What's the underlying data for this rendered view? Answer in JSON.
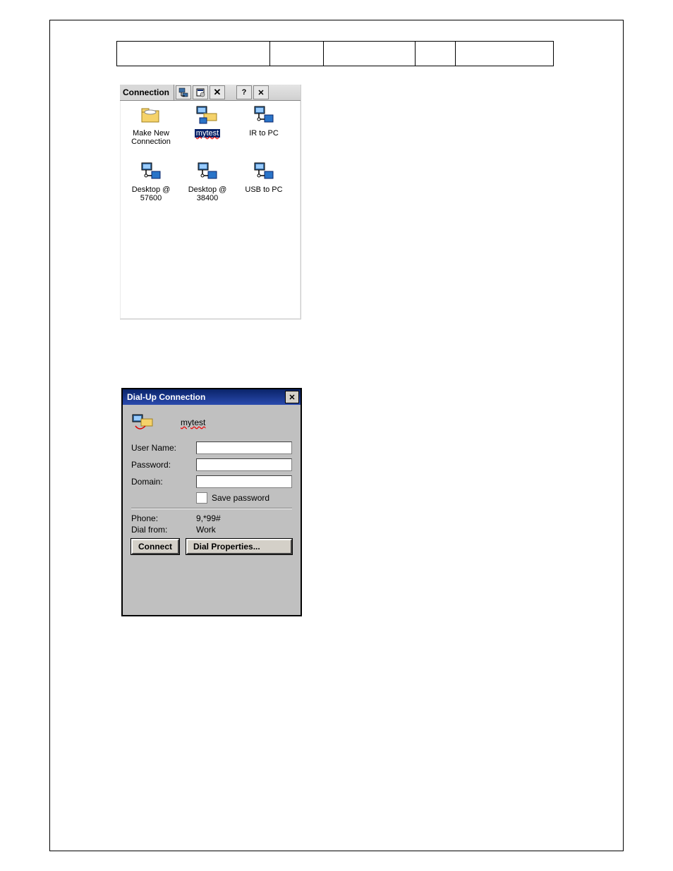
{
  "connection_window": {
    "title": "Connection",
    "toolbar": {
      "btn1_name": "new-connection-icon",
      "btn2_name": "properties-icon",
      "btn3_name": "delete-icon",
      "btn4_name": "help-icon",
      "btn5_name": "close-icon",
      "btn3_label": "✕",
      "btn4_label": "?",
      "btn5_label": "✕"
    },
    "items": [
      {
        "label": "Make New Connection",
        "data_name": "item-make-new-connection",
        "selected": false,
        "icon": "folder"
      },
      {
        "label": "mytest",
        "data_name": "item-mytest",
        "selected": true,
        "icon": "modem"
      },
      {
        "label": "IR to PC",
        "data_name": "item-ir-to-pc",
        "selected": false,
        "icon": "pc-link"
      },
      {
        "label": "Desktop @ 57600",
        "data_name": "item-desktop-57600",
        "selected": false,
        "icon": "pc-link"
      },
      {
        "label": "Desktop @ 38400",
        "data_name": "item-desktop-38400",
        "selected": false,
        "icon": "pc-link"
      },
      {
        "label": "USB to PC",
        "data_name": "item-usb-to-pc",
        "selected": false,
        "icon": "pc-link"
      }
    ]
  },
  "dialup_window": {
    "title": "Dial-Up Connection",
    "connection_name": "mytest",
    "fields": {
      "user_label": "User Name:",
      "user_value": "",
      "pass_label": "Password:",
      "pass_value": "",
      "domain_label": "Domain:",
      "domain_value": "",
      "save_password_label": "Save password"
    },
    "info": {
      "phone_label": "Phone:",
      "phone_value": "9,*99#",
      "dialfrom_label": "Dial from:",
      "dialfrom_value": "Work"
    },
    "buttons": {
      "connect": "Connect",
      "dial_properties": "Dial Properties..."
    }
  }
}
